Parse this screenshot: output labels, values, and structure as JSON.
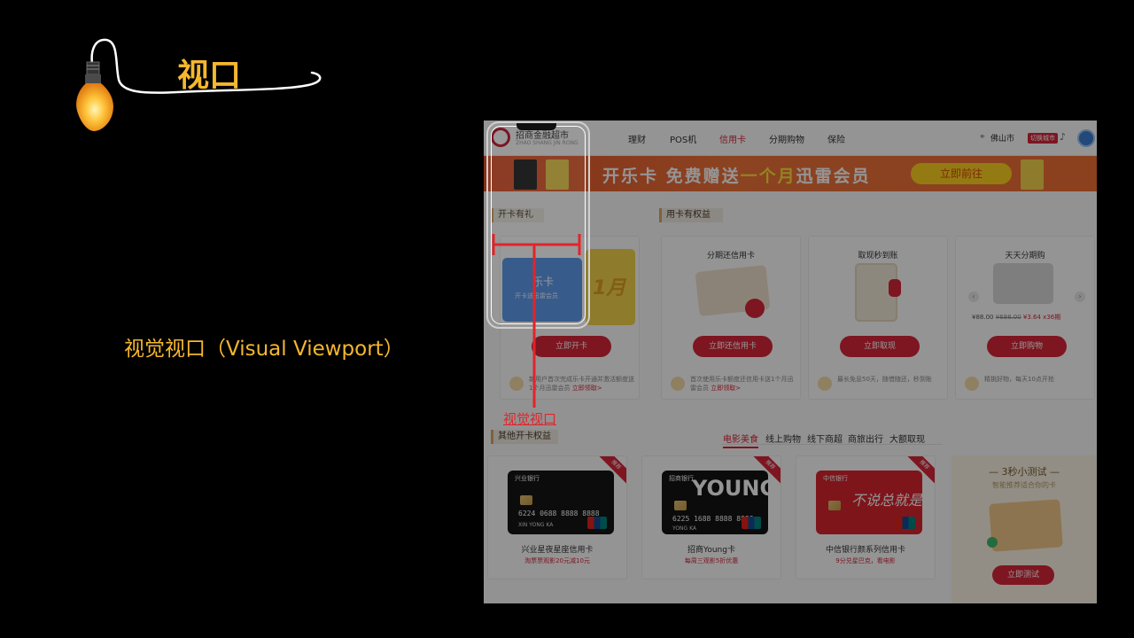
{
  "slide": {
    "title": "视口",
    "subtitle": "视觉视口（Visual Viewport）",
    "viewport_label": "视觉视口",
    "accent_color": "#f5b72e",
    "marker_color": "#e2242a"
  },
  "site": {
    "logo_text": "招商金融超市",
    "logo_sub": "ZHAO SHANG JIN RONG",
    "nav": [
      "理财",
      "POS机",
      "信用卡",
      "分期购物",
      "保险"
    ],
    "nav_active": "信用卡",
    "city": "佛山市",
    "city_badge": "切换城市",
    "banner": {
      "text_a": "开乐卡 免费赠送",
      "text_highlight": "一个月",
      "text_b": "迅雷会员",
      "button": "立即前往"
    },
    "section_left": "开卡有礼",
    "section_right": "用卡有权益",
    "panels": [
      {
        "title": "",
        "card_title": "乐卡",
        "card_sub": "开卡送迅雷会员",
        "promo": "1月",
        "button": "立即开卡",
        "tip_a": "新用户首次完成乐卡开通并激活额度送1个月迅雷会员",
        "tip_link": "立即领取>"
      },
      {
        "title": "分期还信用卡",
        "button": "立即还信用卡",
        "tip_a": "首次使用乐卡额度还信用卡送1个月迅雷会员",
        "tip_link": "立即领取>"
      },
      {
        "title": "取现秒到账",
        "button": "立即取现",
        "tip_a": "最长免息50天，随借随还，秒到账",
        "tip_link": ""
      },
      {
        "title": "天天分期购",
        "button": "立即购物",
        "price_a": "¥88.00",
        "price_old": "¥688.00",
        "price_b": "¥3.64 x36期",
        "tip_a": "精挑好物，每天10点开抢",
        "tip_link": ""
      }
    ],
    "section_other": "其他开卡权益",
    "category_tabs": [
      "电影美食",
      "线上购物",
      "线下商超",
      "商旅出行",
      "大额取现"
    ],
    "category_active": "电影美食",
    "credit_cards": [
      {
        "name": "兴业星夜星座信用卡",
        "sub": "淘票票观影20元减10元",
        "bank": "兴业银行",
        "number": "6224 0688 8888 8888",
        "holder": "XIN YONG KA",
        "corner": "推荐",
        "color": "#1a1a1a"
      },
      {
        "name": "招商Young卡",
        "sub": "每周三观影5折优惠",
        "bank": "招商银行",
        "number": "6225 1688 8888 8888",
        "holder": "YONG KA",
        "corner": "推荐",
        "color": "#151515",
        "headline": "YOUNG"
      },
      {
        "name": "中信银行颜系列信用卡",
        "sub": "9分兑星巴克，看电影",
        "bank": "中信银行",
        "headline": "不说总就是",
        "corner": "推荐",
        "color": "#d9252f"
      }
    ],
    "quiz": {
      "title": "— 3秒小测试 —",
      "subtitle": "智能推荐适合你的卡",
      "button": "立即测试"
    }
  },
  "icons": [
    "lightbulb-icon",
    "location-icon",
    "bag-icon",
    "bell-icon",
    "avatar-icon",
    "chevron-left-icon",
    "chevron-right-icon"
  ]
}
